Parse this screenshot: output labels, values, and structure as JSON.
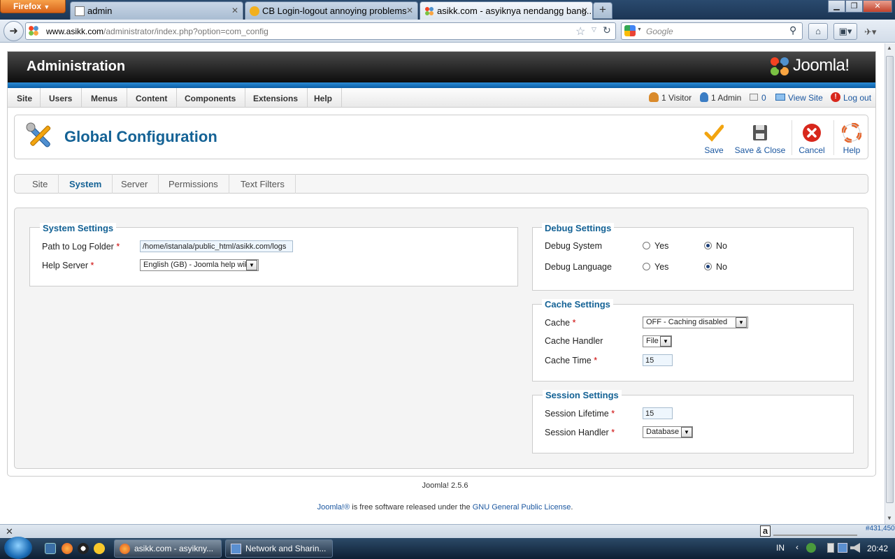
{
  "browser": {
    "menu_button": "Firefox",
    "tabs": [
      {
        "title": "admin"
      },
      {
        "title": "CB Login-logout annoying problems"
      },
      {
        "title": "asikk.com - asyiknya nendangg bang..."
      }
    ],
    "url_host": "www.asikk.com",
    "url_path": "/administrator/index.php?option=com_config",
    "search_placeholder": "Google",
    "icons": [
      "back-icon",
      "star-icon",
      "reload-icon",
      "google-icon",
      "search-icon",
      "home-icon",
      "bookmarks-icon",
      "addon-icon"
    ]
  },
  "admin": {
    "header_title": "Administration",
    "logo_text": "Joomla!",
    "menu": [
      "Site",
      "Users",
      "Menus",
      "Content",
      "Components",
      "Extensions",
      "Help"
    ],
    "status": {
      "visitors": "1 Visitor",
      "admins": "1 Admin",
      "messages": "0",
      "view_site": "View Site",
      "logout": "Log out"
    }
  },
  "toolbar": {
    "title": "Global Configuration",
    "buttons": [
      "Save",
      "Save & Close",
      "Cancel",
      "Help"
    ]
  },
  "config_tabs": {
    "items": [
      "Site",
      "System",
      "Server",
      "Permissions",
      "Text Filters"
    ],
    "active": "System"
  },
  "system_settings": {
    "legend": "System Settings",
    "log_path_label": "Path to Log Folder",
    "log_path_value": "/home/istanala/public_html/asikk.com/logs",
    "help_server_label": "Help Server",
    "help_server_value": "English (GB) - Joomla help wiki"
  },
  "debug_settings": {
    "legend": "Debug Settings",
    "debug_system_label": "Debug System",
    "debug_language_label": "Debug Language",
    "yes": "Yes",
    "no": "No",
    "debug_system_value": "No",
    "debug_language_value": "No"
  },
  "cache_settings": {
    "legend": "Cache Settings",
    "cache_label": "Cache",
    "cache_value": "OFF - Caching disabled",
    "handler_label": "Cache Handler",
    "handler_value": "File",
    "time_label": "Cache Time",
    "time_value": "15"
  },
  "session_settings": {
    "legend": "Session Settings",
    "lifetime_label": "Session Lifetime",
    "lifetime_value": "15",
    "handler_label": "Session Handler",
    "handler_value": "Database"
  },
  "required_marker": "*",
  "footer": {
    "version": "Joomla! 2.5.6",
    "license_prefix": "Joomla!®",
    "license_middle": "is free software released under the",
    "license_link": "GNU General Public License",
    "license_suffix": "."
  },
  "addon_bar": {
    "counter": "#431,450"
  },
  "taskbar": {
    "tasks": [
      "asikk.com - asyikny...",
      "Network and Sharin..."
    ],
    "language": "IN",
    "clock": "20:42"
  },
  "colors": {
    "joomla_blue": "#146295",
    "header_dark": "#0d0d0d",
    "accent_blue": "#2a8bd6",
    "cancel_red": "#d8271c",
    "save_orange": "#f2a40f"
  }
}
